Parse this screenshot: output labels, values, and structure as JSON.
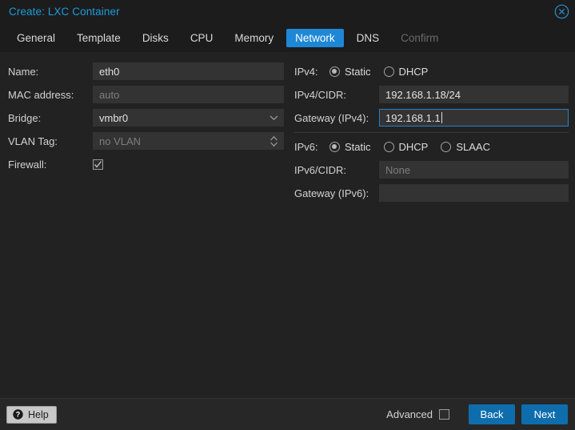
{
  "window": {
    "title": "Create: LXC Container",
    "close_icon": "close-circle-icon"
  },
  "tabs": [
    {
      "label": "General",
      "state": "normal"
    },
    {
      "label": "Template",
      "state": "normal"
    },
    {
      "label": "Disks",
      "state": "normal"
    },
    {
      "label": "CPU",
      "state": "normal"
    },
    {
      "label": "Memory",
      "state": "normal"
    },
    {
      "label": "Network",
      "state": "active"
    },
    {
      "label": "DNS",
      "state": "normal"
    },
    {
      "label": "Confirm",
      "state": "disabled"
    }
  ],
  "left_form": {
    "name": {
      "label": "Name:",
      "value": "eth0",
      "placeholder": ""
    },
    "mac_address": {
      "label": "MAC address:",
      "value": "",
      "placeholder": "auto"
    },
    "bridge": {
      "label": "Bridge:",
      "value": "vmbr0",
      "arrow_icon": "chevron-down-icon"
    },
    "vlan_tag": {
      "label": "VLAN Tag:",
      "value": "",
      "placeholder": "no VLAN",
      "arrow_icon": "spinner-updown-icon"
    },
    "firewall": {
      "label": "Firewall:",
      "checked": true
    }
  },
  "right_form": {
    "ipv4_mode": {
      "label": "IPv4:",
      "options": [
        {
          "label": "Static",
          "selected": true
        },
        {
          "label": "DHCP",
          "selected": false
        }
      ]
    },
    "ipv4_cidr": {
      "label": "IPv4/CIDR:",
      "value": "192.168.1.18/24",
      "placeholder": ""
    },
    "ipv4_gateway": {
      "label": "Gateway (IPv4):",
      "value": "192.168.1.1",
      "placeholder": "",
      "focused": true
    },
    "ipv6_mode": {
      "label": "IPv6:",
      "options": [
        {
          "label": "Static",
          "selected": true
        },
        {
          "label": "DHCP",
          "selected": false
        },
        {
          "label": "SLAAC",
          "selected": false
        }
      ]
    },
    "ipv6_cidr": {
      "label": "IPv6/CIDR:",
      "value": "",
      "placeholder": "None"
    },
    "ipv6_gateway": {
      "label": "Gateway (IPv6):",
      "value": "",
      "placeholder": ""
    }
  },
  "toolbar": {
    "help_label": "Help",
    "help_icon": "question-circle-icon",
    "advanced_label": "Advanced",
    "advanced_checked": false,
    "back_label": "Back",
    "next_label": "Next"
  },
  "colors": {
    "accent_blue": "#1e87d6",
    "button_blue": "#0e6dad",
    "title_blue": "#1f9bdd",
    "focus_border": "#2580c9",
    "window_bg": "#222222",
    "titlebar_bg": "#1c1c1c",
    "field_bg": "#333333",
    "toolbar_bg": "#272727"
  }
}
